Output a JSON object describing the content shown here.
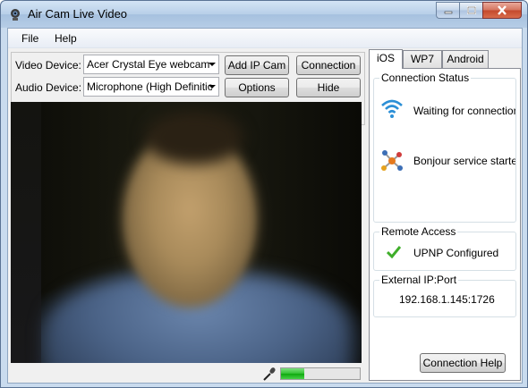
{
  "window": {
    "title": "Air Cam Live Video"
  },
  "menu": {
    "file": "File",
    "help": "Help"
  },
  "devices": {
    "video_label": "Video Device:",
    "video_value": "Acer Crystal Eye webcam",
    "audio_label": "Audio Device:",
    "audio_value": "Microphone (High Definition"
  },
  "buttons": {
    "add_ip_cam": "Add IP Cam",
    "connection": "Connection",
    "options": "Options",
    "hide": "Hide",
    "connection_help": "Connection Help"
  },
  "tabs": {
    "ios": "iOS",
    "wp7": "WP7",
    "android": "Android"
  },
  "connection_status": {
    "title": "Connection Status",
    "wifi_text": "Waiting for connection...",
    "bonjour_text": "Bonjour service started..."
  },
  "remote_access": {
    "title": "Remote Access",
    "upnp_text": "UPNP Configured"
  },
  "external_ip": {
    "title": "External IP:Port",
    "value": "192.168.1.145:1726"
  },
  "audio_level": {
    "fraction": 0.3
  },
  "colors": {
    "accent_blue": "#2b8fd6",
    "level_green": "#2fbf2f",
    "check_green": "#3fae2a"
  }
}
